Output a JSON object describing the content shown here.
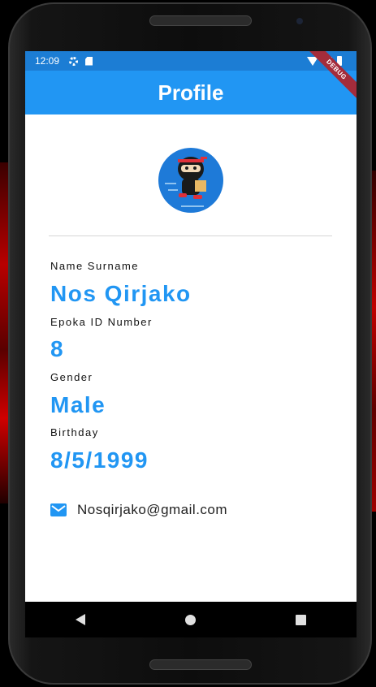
{
  "status_bar": {
    "time": "12:09",
    "icons": [
      "gear-icon",
      "sim-card-icon",
      "wifi-icon",
      "signal-icon",
      "battery-icon"
    ]
  },
  "app_bar": {
    "title": "Profile",
    "debug_banner": "DEBUG"
  },
  "profile": {
    "avatar": "ninja-avatar",
    "fields": [
      {
        "label": "Name Surname",
        "value": "Nos Qirjako"
      },
      {
        "label": "Epoka ID Number",
        "value": "8"
      },
      {
        "label": "Gender",
        "value": "Male"
      },
      {
        "label": "Birthday",
        "value": "8/5/1999"
      }
    ],
    "email": "Nosqirjako@gmail.com",
    "email_icon": "mail-icon"
  },
  "nav_bar": {
    "buttons": [
      "back-icon",
      "home-icon",
      "recent-apps-icon"
    ]
  },
  "colors": {
    "primary": "#2196f3",
    "status_bar": "#1c7dd4",
    "avatar_bg": "#1e7ad8",
    "debug_banner": "#a42c3b"
  }
}
